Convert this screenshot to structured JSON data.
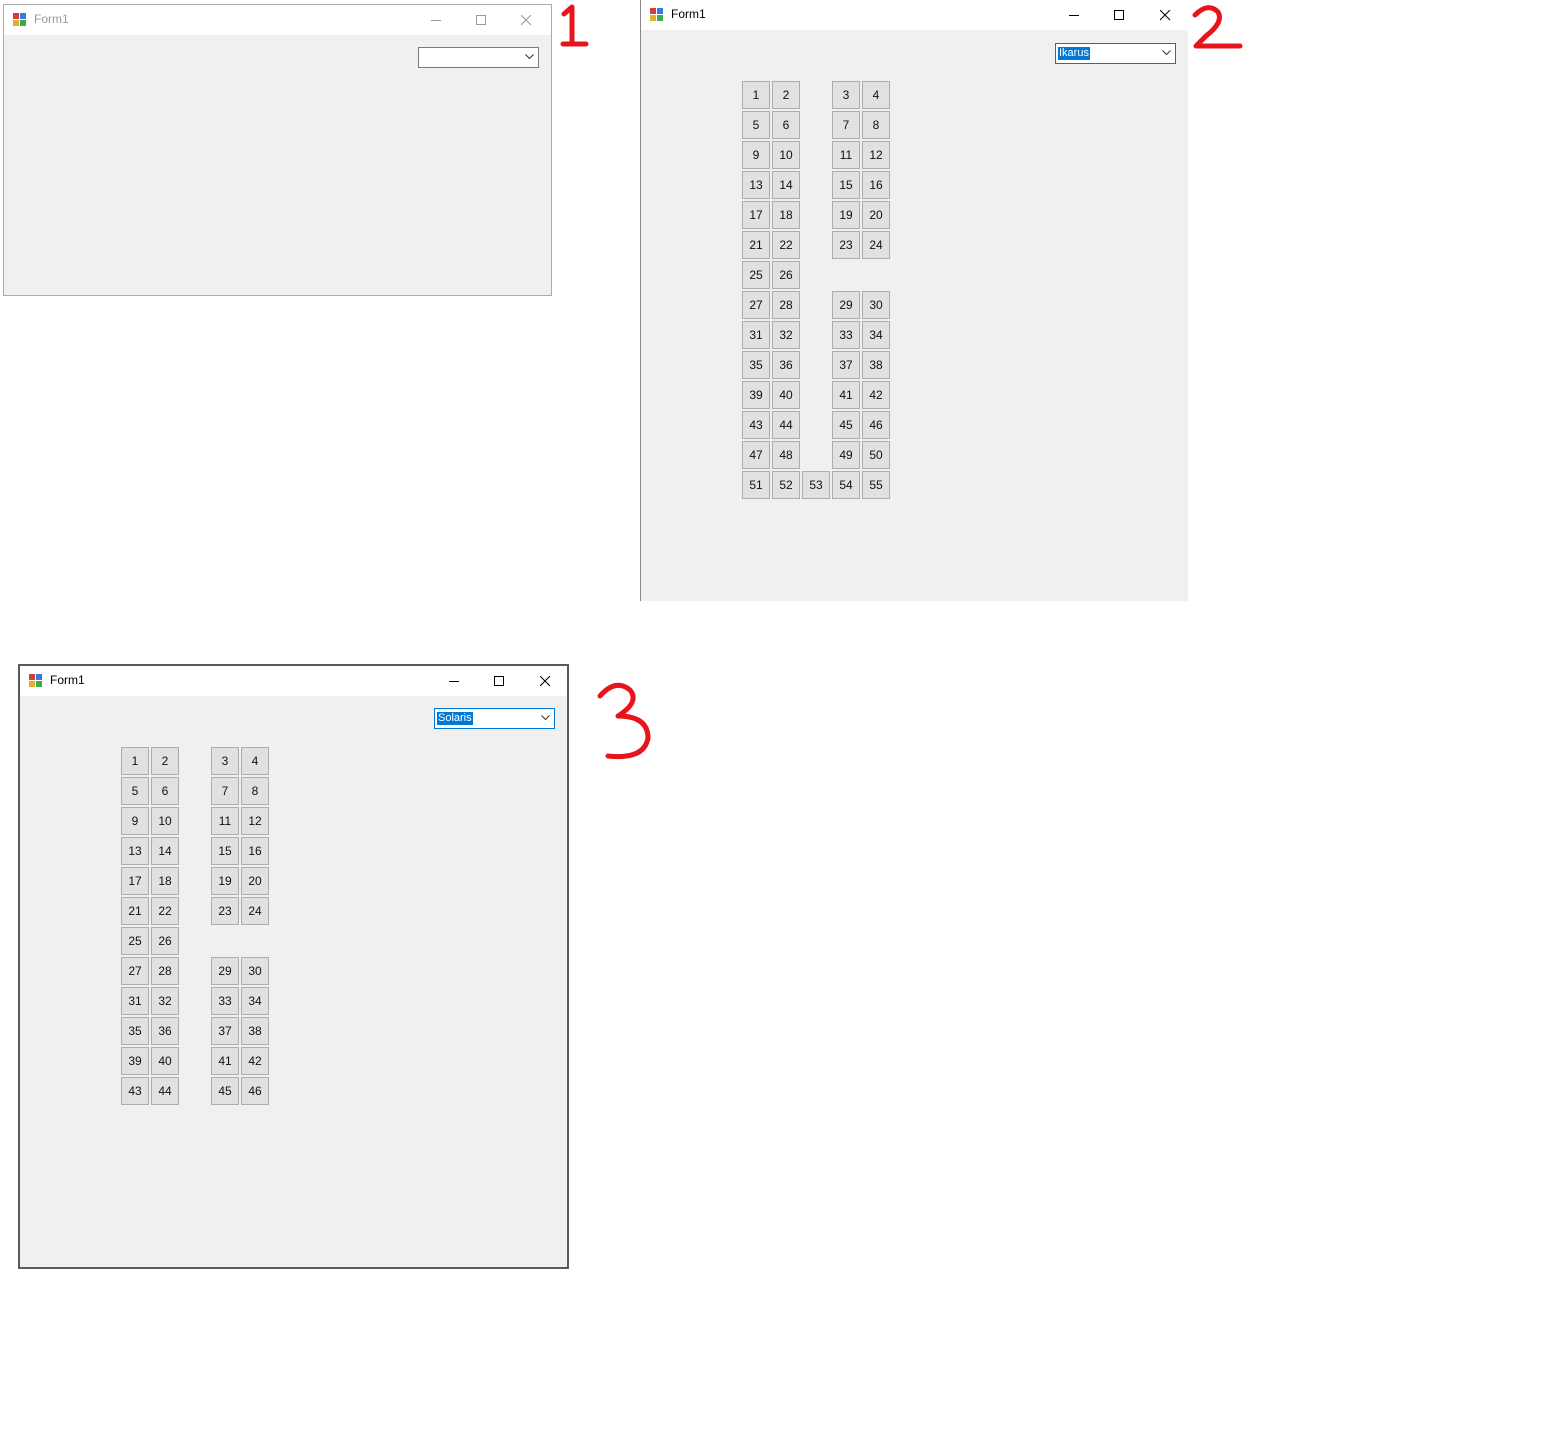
{
  "colors": {
    "window_bg": "#f0f0f0",
    "titlebar_bg": "#ffffff",
    "title_text_active": "#000000",
    "title_text_inactive": "#999999",
    "seat_bg": "#e1e1e1",
    "seat_border": "#adadad",
    "selection_bg": "#0078d7",
    "annotation_red": "#e8141c"
  },
  "icons": {
    "app": "winforms-app-icon",
    "minimize": "minimize-icon",
    "maximize": "maximize-icon",
    "close": "close-icon",
    "dropdown": "chevron-down-icon"
  },
  "windows": [
    {
      "marker": "1",
      "title": "Form1",
      "active": false,
      "combo_value": "",
      "seats": []
    },
    {
      "marker": "2",
      "title": "Form1",
      "active": true,
      "combo_value": "Ikarus",
      "seats": [
        "1",
        "2",
        "3",
        "4",
        "5",
        "6",
        "7",
        "8",
        "9",
        "10",
        "11",
        "12",
        "13",
        "14",
        "15",
        "16",
        "17",
        "18",
        "19",
        "20",
        "21",
        "22",
        "23",
        "24",
        "25",
        "26",
        "27",
        "28",
        "29",
        "30",
        "31",
        "32",
        "33",
        "34",
        "35",
        "36",
        "37",
        "38",
        "39",
        "40",
        "41",
        "42",
        "43",
        "44",
        "45",
        "46",
        "47",
        "48",
        "49",
        "50",
        "51",
        "52",
        "53",
        "54",
        "55"
      ]
    },
    {
      "marker": "3",
      "title": "Form1",
      "active": true,
      "combo_value": "Solaris",
      "seats": [
        "1",
        "2",
        "3",
        "4",
        "5",
        "6",
        "7",
        "8",
        "9",
        "10",
        "11",
        "12",
        "13",
        "14",
        "15",
        "16",
        "17",
        "18",
        "19",
        "20",
        "21",
        "22",
        "23",
        "24",
        "25",
        "26",
        "27",
        "28",
        "29",
        "30",
        "31",
        "32",
        "33",
        "34",
        "35",
        "36",
        "37",
        "38",
        "39",
        "40",
        "41",
        "42",
        "43",
        "44",
        "45",
        "46"
      ]
    }
  ]
}
